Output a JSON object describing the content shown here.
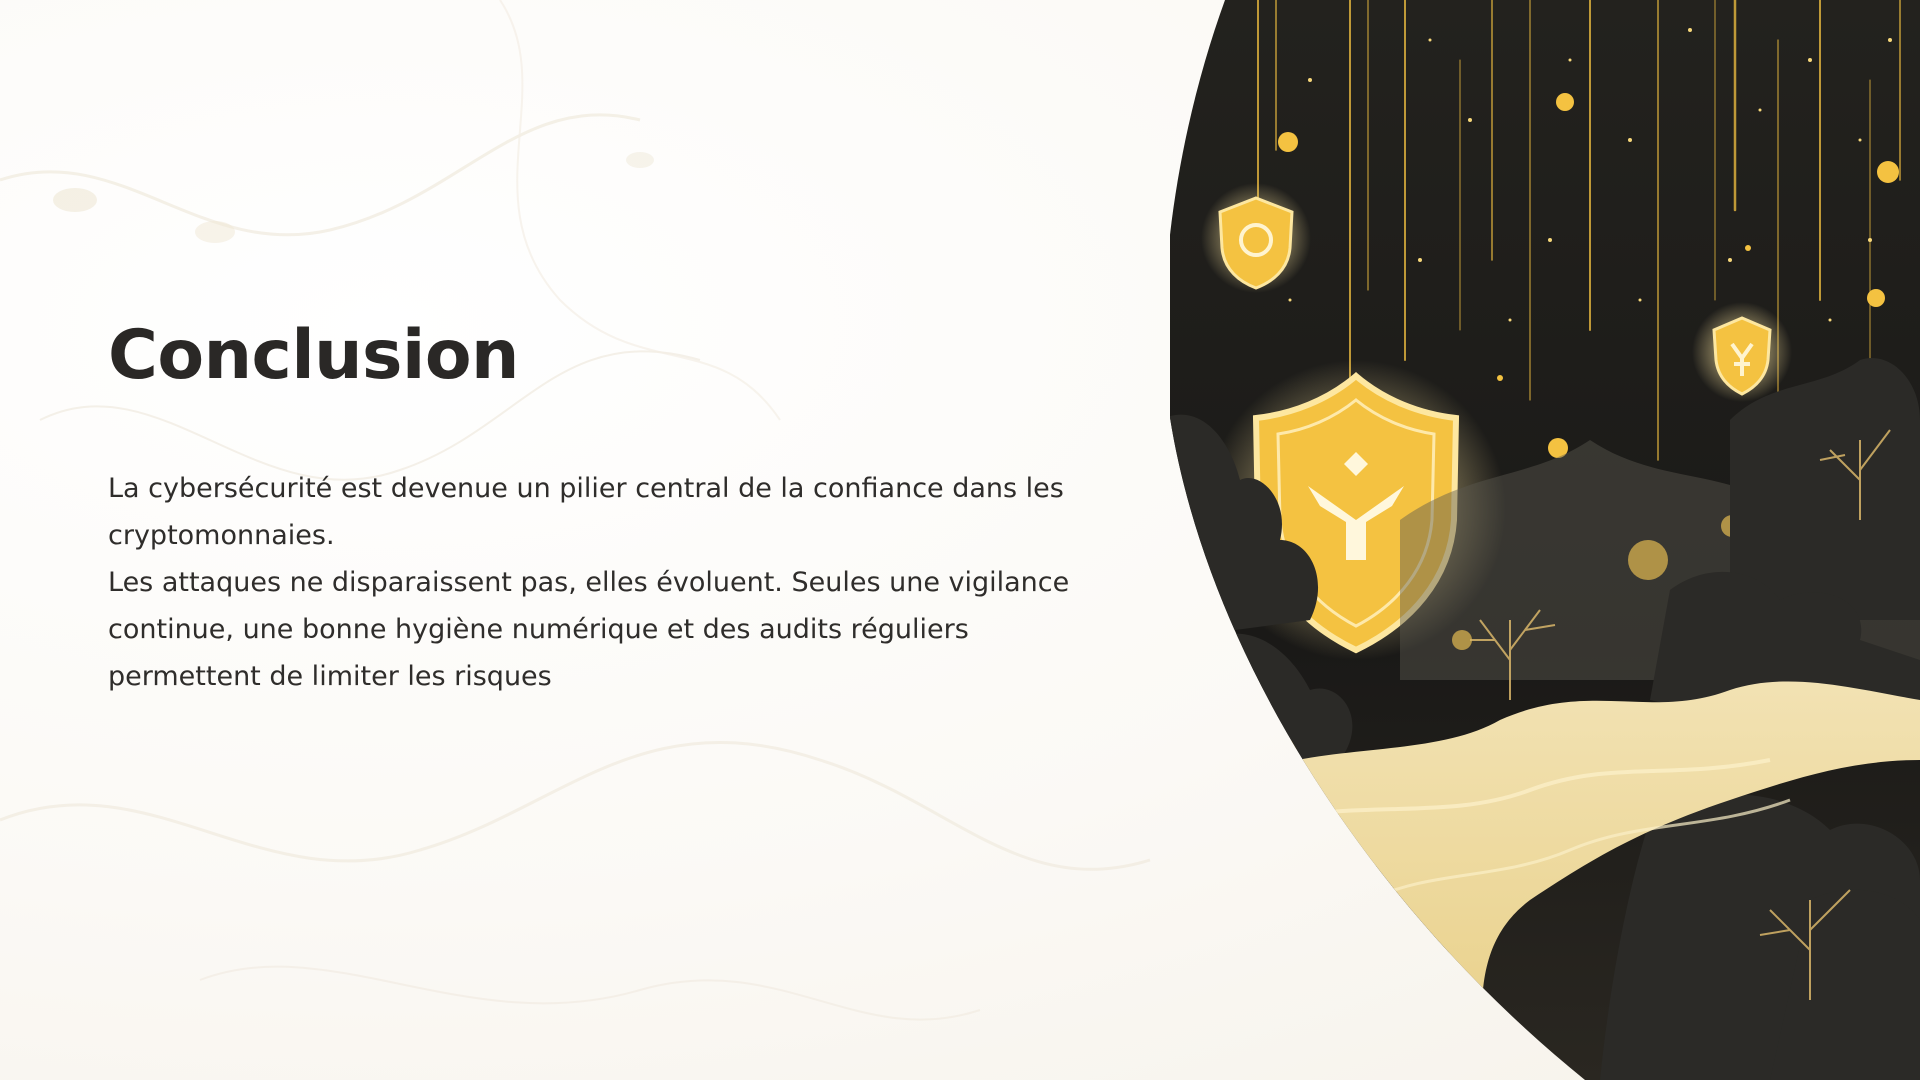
{
  "slide": {
    "title": "Conclusion",
    "body": "La cybersécurité est devenue un pilier central de la confiance dans les cryptomonnaies.\n Les attaques ne disparaissent pas, elles évoluent. Seules une vigilance continue, une bonne hygiène numérique et des audits réguliers permettent de limiter les risques"
  },
  "illustration": {
    "subject": "gold-shield-crypto-forest",
    "colors": {
      "night": "#1c1b18",
      "gold": "#f4c241",
      "gold_light": "#fde7a0",
      "path": "#f3dfa0",
      "bush": "#2b2a27"
    }
  }
}
